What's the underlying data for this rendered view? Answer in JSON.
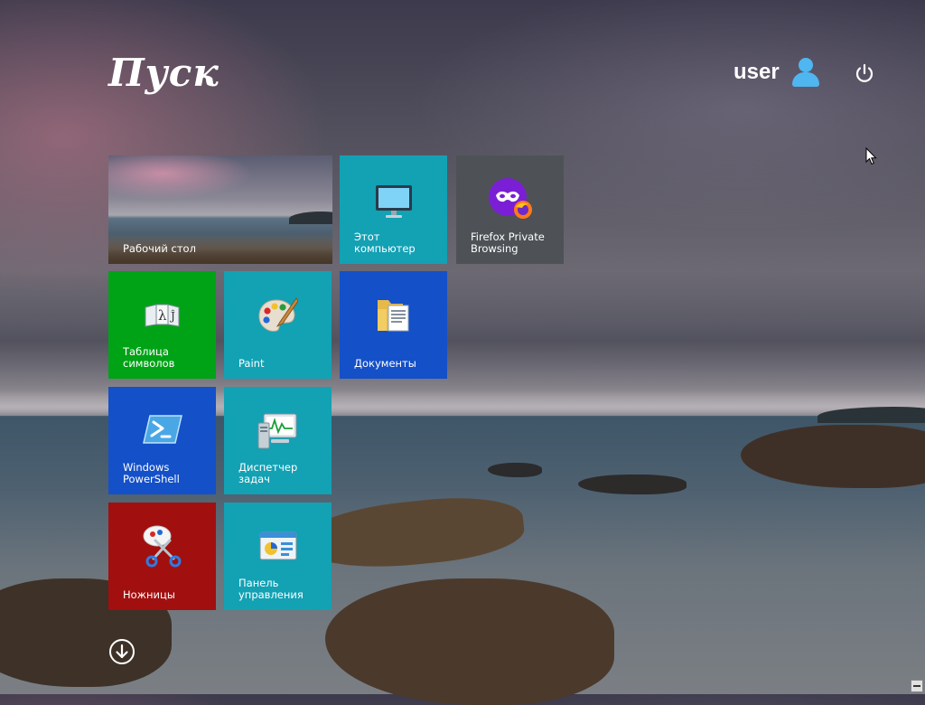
{
  "header": {
    "title": "Пуск",
    "user_name": "user",
    "user_icon": "user-icon",
    "power_icon": "power-icon"
  },
  "tiles": [
    {
      "id": "desktop",
      "label": "Рабочий стол",
      "icon": "desktop-wallpaper",
      "color": "#5b6f80"
    },
    {
      "id": "computer",
      "label": "Этот компьютер",
      "icon": "monitor-icon",
      "color": "#13a1b4"
    },
    {
      "id": "firefox",
      "label": "Firefox Private\nBrowsing",
      "icon": "firefox-private-icon",
      "color": "#4e5256"
    },
    {
      "id": "charmap",
      "label": "Таблица\nсимволов",
      "icon": "charmap-icon",
      "color": "#00a316"
    },
    {
      "id": "paint",
      "label": "Paint",
      "icon": "paint-palette-icon",
      "color": "#13a1b4"
    },
    {
      "id": "docs",
      "label": "Документы",
      "icon": "documents-folder-icon",
      "color": "#1450c8"
    },
    {
      "id": "powershell",
      "label": "Windows\nPowerShell",
      "icon": "powershell-icon",
      "color": "#1450c8"
    },
    {
      "id": "taskmgr",
      "label": "Диспетчер\nзадач",
      "icon": "task-manager-icon",
      "color": "#13a1b4"
    },
    {
      "id": "snip",
      "label": "Ножницы",
      "icon": "scissors-icon",
      "color": "#a20f0f"
    },
    {
      "id": "cpanel",
      "label": "Панель\nуправления",
      "icon": "control-panel-icon",
      "color": "#13a1b4"
    }
  ],
  "footer": {
    "all_apps_icon": "arrow-down-circle-icon"
  }
}
